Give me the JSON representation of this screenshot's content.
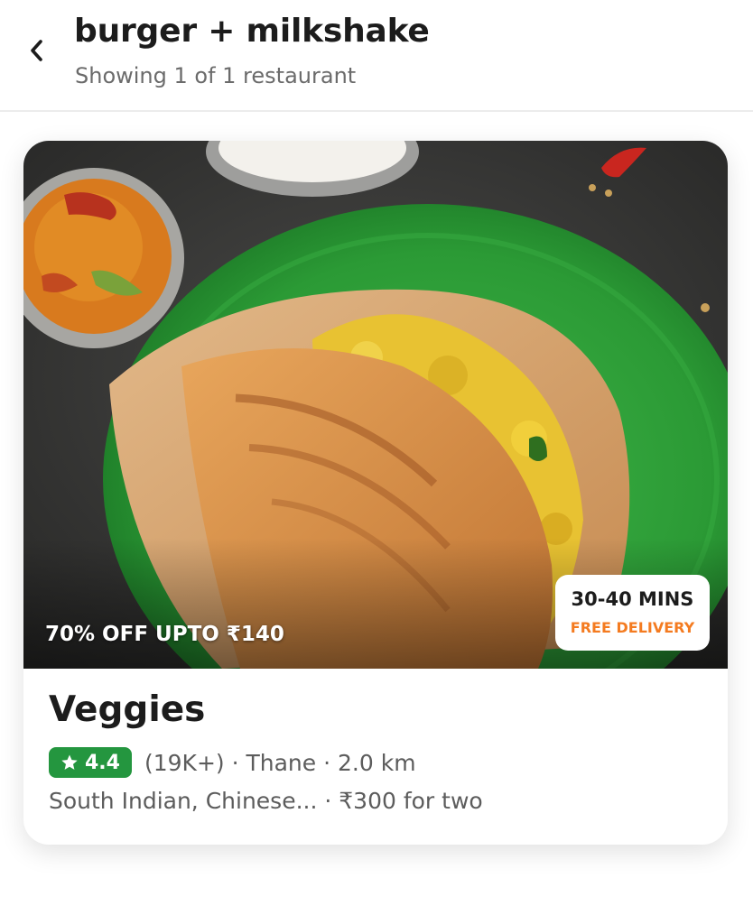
{
  "header": {
    "title": "burger + milkshake",
    "subtitle": "Showing 1 of 1 restaurant"
  },
  "restaurant": {
    "offer": "70% OFF UPTO ₹140",
    "eta": "30-40 MINS",
    "delivery": "FREE DELIVERY",
    "name": "Veggies",
    "rating": "4.4",
    "reviews": "(19K+)",
    "location": "Thane",
    "distance": "2.0 km",
    "meta_separator": " · ",
    "cuisines": "South Indian, Chinese...",
    "cost": "₹300 for two"
  },
  "icons": {
    "back": "chevron-left-icon",
    "rating": "star-icon"
  },
  "colors": {
    "rating_green": "#24963f",
    "delivery_orange": "#f47b20",
    "plate_green": "#2e9a3a"
  }
}
